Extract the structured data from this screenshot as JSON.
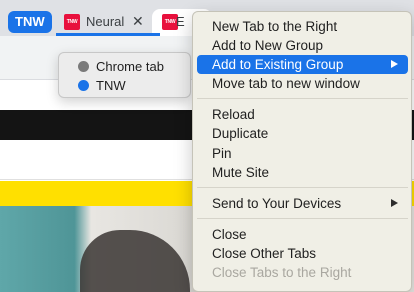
{
  "tabstrip": {
    "group_chip": "TNW",
    "tabs": [
      {
        "title": "Neural",
        "favicon_text": "TNW",
        "close": "✕"
      },
      {
        "title": "E",
        "favicon_text": "TNW"
      }
    ]
  },
  "colors": {
    "group_blue": "#1a73e8",
    "favicon_red": "#e8103d",
    "menu_highlight": "#1a73e8",
    "brand_yellow": "#ffe000",
    "chrome_tab_dot": "#7a7a7a",
    "tnw_dot": "#1a73e8"
  },
  "submenu": {
    "items": [
      {
        "label": "Chrome tab",
        "dot_color": "#7a7a7a"
      },
      {
        "label": "TNW",
        "dot_color": "#1a73e8"
      }
    ]
  },
  "context_menu": {
    "items": [
      {
        "label": "New Tab to the Right"
      },
      {
        "label": "Add to New Group"
      },
      {
        "label": "Add to Existing Group",
        "highlighted": true,
        "has_submenu": true
      },
      {
        "label": "Move tab to new window"
      },
      {
        "label": "Reload"
      },
      {
        "label": "Duplicate"
      },
      {
        "label": "Pin"
      },
      {
        "label": "Mute Site"
      },
      {
        "label": "Send to Your Devices",
        "has_submenu": true
      },
      {
        "label": "Close"
      },
      {
        "label": "Close Other Tabs"
      },
      {
        "label": "Close Tabs to the Right",
        "disabled": true
      }
    ]
  }
}
